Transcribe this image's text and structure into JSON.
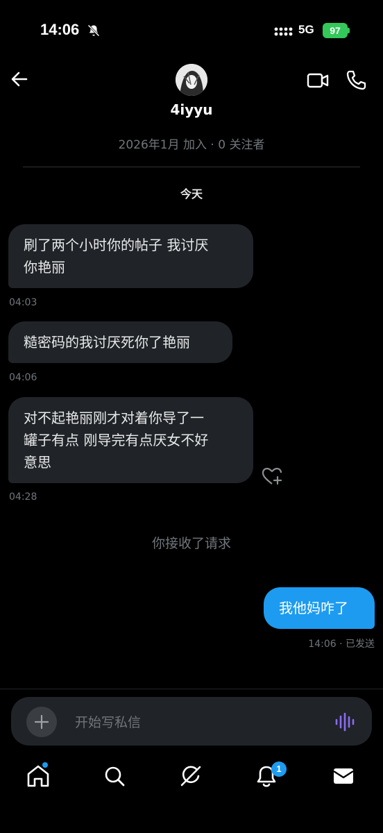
{
  "status_bar": {
    "time": "14:06",
    "network": "5G",
    "battery": "97"
  },
  "header": {
    "username": "4iyyu",
    "meta": "2026年1月 加入 · 0 关注者"
  },
  "date_separator": "今天",
  "messages": [
    {
      "text_lines": [
        "刷了两个小时你的帖子 我讨厌",
        "你艳丽"
      ],
      "time": "04:03"
    },
    {
      "text_lines": [
        "糙密码的我讨厌死你了艳丽"
      ],
      "time": "04:06"
    },
    {
      "text_lines": [
        "对不起艳丽刚才对着你导了一",
        "罐子有点 刚导完有点厌女不好",
        "意思"
      ],
      "time": "04:28"
    }
  ],
  "system_message": "你接收了请求",
  "sent_message": {
    "text": "我他妈咋了",
    "status": "14:06 · 已发送"
  },
  "composer": {
    "placeholder": "开始写私信"
  },
  "nav": {
    "notifications_badge": "1"
  },
  "colors": {
    "accent": "#1d9bf0",
    "bubble_in": "#202327",
    "battery": "#34c759"
  }
}
